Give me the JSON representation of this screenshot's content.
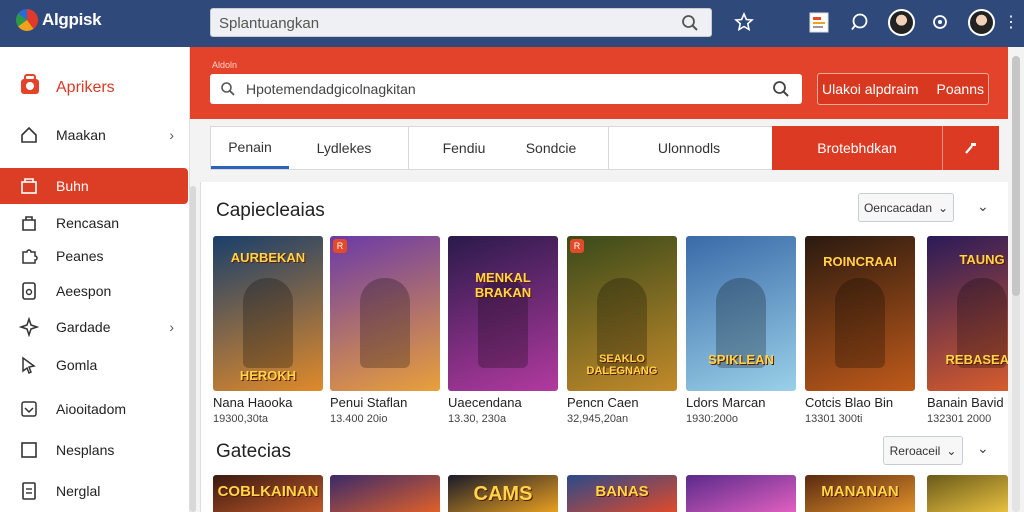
{
  "app": {
    "name": "Algpisk"
  },
  "topbar": {
    "search_placeholder": "Splantuangkan"
  },
  "sidebar": {
    "brand": "Aprikers",
    "items": [
      {
        "label": "Maakan",
        "icon": "home-icon",
        "chevron": true
      },
      {
        "label": "Buhn",
        "icon": "store-icon",
        "active": true
      },
      {
        "label": "Rencasan",
        "icon": "bag-icon"
      },
      {
        "label": "Peanes",
        "icon": "puzzle-icon"
      },
      {
        "label": "Aeespon",
        "icon": "tablet-icon"
      },
      {
        "label": "Gardade",
        "icon": "star-icon",
        "chevron": true
      },
      {
        "label": "Gomla",
        "icon": "cursor-icon"
      },
      {
        "label": "Aiooitadom",
        "icon": "download-icon"
      },
      {
        "label": "Nesplans",
        "icon": "square-icon"
      },
      {
        "label": "Nerglal",
        "icon": "document-icon"
      }
    ]
  },
  "banner": {
    "small_text": "Aldoln",
    "search_text": "Hpotemendadgicolnagkitan",
    "button_left": "Ulakoi alpdraim",
    "button_right": "Poanns"
  },
  "tabs": [
    {
      "label": "Penain",
      "selected": true
    },
    {
      "label": "Lydlekes"
    },
    {
      "label": "Fendiu"
    },
    {
      "label": "Sondcie"
    },
    {
      "label": "Ulonnodls"
    }
  ],
  "tab_action": {
    "label": "Brotebhdkan"
  },
  "section1": {
    "title": "Capiecleaias",
    "dropdown": "Oencacadan",
    "cards": [
      {
        "title_art": "AURBEKAN",
        "bottom_art": "HEROKH",
        "name": "Nana Haooka",
        "meta": "19300,30ta",
        "colors": [
          "#1a3f6b",
          "#e08a2a"
        ]
      },
      {
        "title_art": "",
        "name": "Penui Staflan",
        "meta": "13.400 20io",
        "colors": [
          "#6b3aa8",
          "#e9a03a"
        ]
      },
      {
        "title_art": "MENKAL BRAKAN",
        "name": "Uaecendana",
        "meta": "13.30, 230a",
        "colors": [
          "#2a1a4a",
          "#b23aa0"
        ]
      },
      {
        "title_art": "",
        "bottom_art": "SEAKLO DALEGNANG",
        "name": "Pencn Caen",
        "meta": "32,945,20an",
        "colors": [
          "#3a4a1a",
          "#c28a2a"
        ]
      },
      {
        "title_art": "",
        "bottom_art": "SPIKLEAN",
        "name": "Ldors Marcan",
        "meta": "1930:200o",
        "colors": [
          "#3a6aa8",
          "#9ad0e8"
        ]
      },
      {
        "title_art": "ROINCRAAI",
        "name": "Cotcis Blao Bin",
        "meta": "13301 300ti",
        "colors": [
          "#2a1a10",
          "#c05a1a"
        ]
      },
      {
        "title_art": "TAUNG",
        "bottom_art": "REBASEAN",
        "name": "Banain Bavid",
        "meta": "132301 2000",
        "colors": [
          "#2a1a5a",
          "#e0602a"
        ]
      }
    ]
  },
  "section2": {
    "title": "Gatecias",
    "dropdown": "Reroaceil",
    "cards": [
      {
        "title_art": "COBLKAINAN",
        "colors": [
          "#3a1a10",
          "#c0582a"
        ]
      },
      {
        "title_art": "",
        "colors": [
          "#3a2a6a",
          "#e0602a"
        ]
      },
      {
        "title_art": "CAMS",
        "colors": [
          "#1a1a2a",
          "#e8a020"
        ]
      },
      {
        "title_art": "BANAS",
        "colors": [
          "#2a4a8a",
          "#e04a2a"
        ]
      },
      {
        "title_art": "",
        "colors": [
          "#5a2a8a",
          "#e060c0"
        ]
      },
      {
        "title_art": "MANANAN",
        "colors": [
          "#5a2a10",
          "#e0902a"
        ]
      },
      {
        "title_art": "",
        "colors": [
          "#6a5a1a",
          "#e8c040"
        ]
      }
    ]
  }
}
